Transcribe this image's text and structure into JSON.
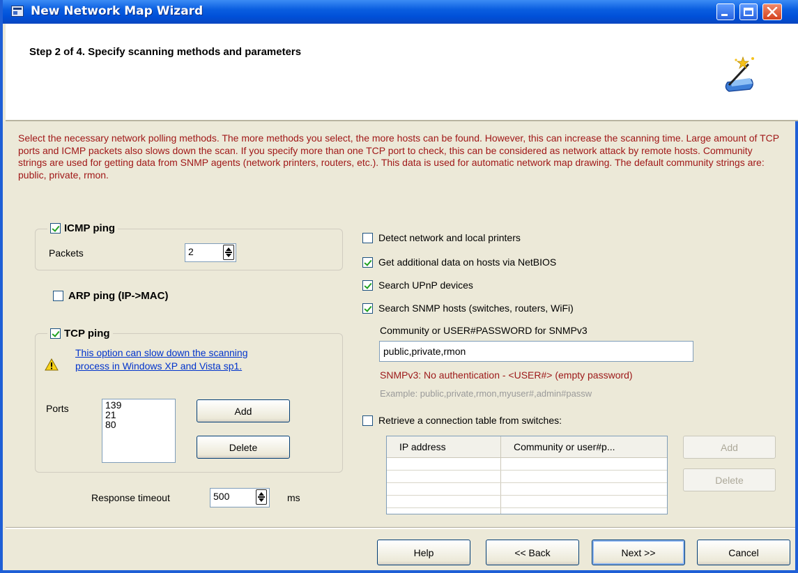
{
  "window": {
    "title": "New Network Map Wizard",
    "accent_color": "#0a5ee0"
  },
  "header": {
    "step_title": "Step 2 of 4. Specify scanning methods and parameters",
    "icon": "wizard-wand-icon"
  },
  "description": "Select the necessary network polling methods. The more methods you select, the more hosts can be found. However, this can increase the scanning time. Large amount of TCP ports and ICMP packets also slows down the scan. If you specify more than one TCP port to check, this can be considered as network attack by remote hosts. Community strings are used for getting data from SNMP agents (network printers, routers, etc.). This data is used for automatic network map drawing. The default community strings are: public, private, rmon.",
  "icmp": {
    "label": "ICMP ping",
    "checked": true,
    "packets_label": "Packets",
    "packets_value": "2"
  },
  "arp": {
    "label": "ARP ping (IP->MAC)",
    "checked": false
  },
  "tcp": {
    "label": "TCP ping",
    "checked": true,
    "warning_line1": "This option can slow down the scanning",
    "warning_line2": "process in Windows XP and Vista sp1.",
    "ports_label": "Ports",
    "ports": [
      "139",
      "21",
      "80"
    ],
    "add_label": "Add",
    "delete_label": "Delete"
  },
  "timeout": {
    "label": "Response timeout",
    "value": "500",
    "unit": "ms"
  },
  "options": {
    "detect_printers": {
      "label": "Detect network and local printers",
      "checked": false
    },
    "netbios": {
      "label": "Get additional data on hosts via NetBIOS",
      "checked": true
    },
    "upnp": {
      "label": "Search UPnP devices",
      "checked": true
    },
    "snmp": {
      "label": "Search SNMP hosts (switches, routers, WiFi)",
      "checked": true
    }
  },
  "snmp": {
    "community_label": "Community or USER#PASSWORD for SNMPv3",
    "community_value": "public,private,rmon",
    "note": "SNMPv3: No authentication - <USER#> (empty password)",
    "example": "Example: public,private,rmon,myuser#,admin#passw"
  },
  "switches": {
    "label": "Retrieve a connection table from switches:",
    "checked": false,
    "columns": [
      "IP address",
      "Community or user#p..."
    ],
    "add_label": "Add",
    "delete_label": "Delete"
  },
  "footer": {
    "help": "Help",
    "back": "<< Back",
    "next": "Next >>",
    "cancel": "Cancel"
  }
}
